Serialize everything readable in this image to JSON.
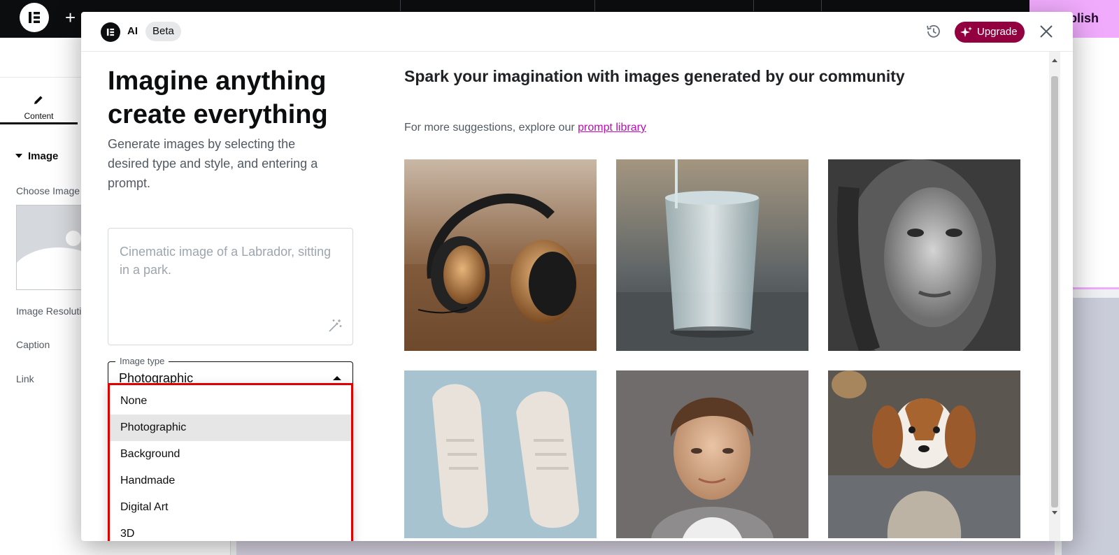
{
  "editor": {
    "publish_label": "Publish",
    "panel": {
      "tab_content": "Content",
      "section_title": "Image",
      "controls": [
        "Choose Image",
        "Image Resoluti",
        "Caption",
        "Link"
      ]
    }
  },
  "modal": {
    "header": {
      "ai_label": "AI",
      "beta_label": "Beta",
      "upgrade_label": "Upgrade"
    },
    "left": {
      "title": "Imagine anything create everything",
      "description": "Generate images by selecting the desired type and style, and entering a prompt.",
      "prompt_placeholder": "Cinematic image of a Labrador, sitting in a park.",
      "image_type_label": "Image type",
      "image_type_value": "Photographic",
      "options": [
        "None",
        "Photographic",
        "Background",
        "Handmade",
        "Digital Art",
        "3D"
      ],
      "selected_option": "Photographic"
    },
    "right": {
      "heading": "Spark your imagination with images generated by our community",
      "suggestion_text": "For more suggestions, explore our",
      "suggestion_link": "prompt library",
      "images": [
        "headphones-image",
        "water-glass-image",
        "woman-portrait-image",
        "sneakers-image",
        "boy-portrait-image",
        "dog-sweater-image"
      ]
    }
  },
  "colors": {
    "accent": "#93003f",
    "link": "#c00bb9",
    "highlight_border": "#e00000",
    "publish_bg": "#f0abfc"
  }
}
